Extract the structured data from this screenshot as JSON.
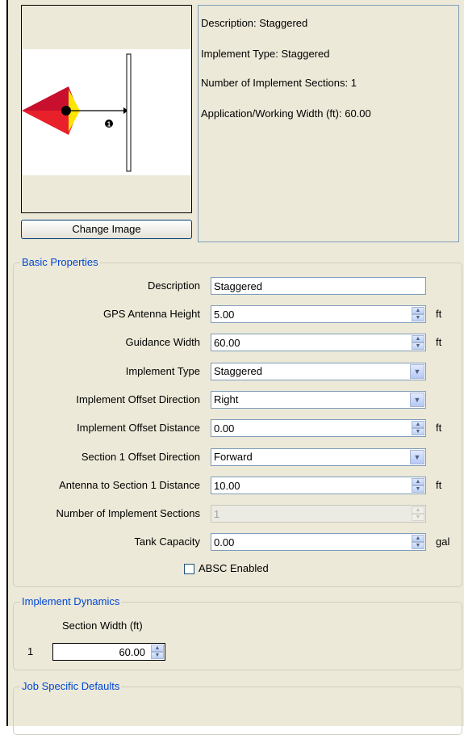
{
  "preview": {
    "change_image_label": "Change Image",
    "section_number": "1",
    "colors": {
      "tip": "#c8102e",
      "body": "#e8202a",
      "fill": "#ffe600",
      "hitch": "#000000"
    }
  },
  "info": {
    "description": "Description: Staggered",
    "implement_type": "Implement Type: Staggered",
    "sections": "Number of Implement Sections: 1",
    "width": "Application/Working Width (ft): 60.00"
  },
  "basic": {
    "title": "Basic Properties",
    "description_label": "Description",
    "description_value": "Staggered",
    "gps_height_label": "GPS Antenna Height",
    "gps_height_value": "5.00",
    "gps_height_unit": "ft",
    "guidance_width_label": "Guidance Width",
    "guidance_width_value": "60.00",
    "guidance_width_unit": "ft",
    "implement_type_label": "Implement Type",
    "implement_type_value": "Staggered",
    "offset_dir_label": "Implement Offset Direction",
    "offset_dir_value": "Right",
    "offset_dist_label": "Implement Offset Distance",
    "offset_dist_value": "0.00",
    "offset_dist_unit": "ft",
    "sec1_dir_label": "Section 1 Offset Direction",
    "sec1_dir_value": "Forward",
    "antenna_sec1_label": "Antenna to Section 1 Distance",
    "antenna_sec1_value": "10.00",
    "antenna_sec1_unit": "ft",
    "num_sections_label": "Number of Implement Sections",
    "num_sections_value": "1",
    "tank_label": "Tank Capacity",
    "tank_value": "0.00",
    "tank_unit": "gal",
    "absc_label": "ABSC Enabled",
    "absc_checked": false
  },
  "dynamics": {
    "title": "Implement Dynamics",
    "section_width_header": "Section Width (ft)",
    "rows": [
      {
        "index": "1",
        "value": "60.00"
      }
    ]
  },
  "job": {
    "title": "Job Specific Defaults"
  }
}
